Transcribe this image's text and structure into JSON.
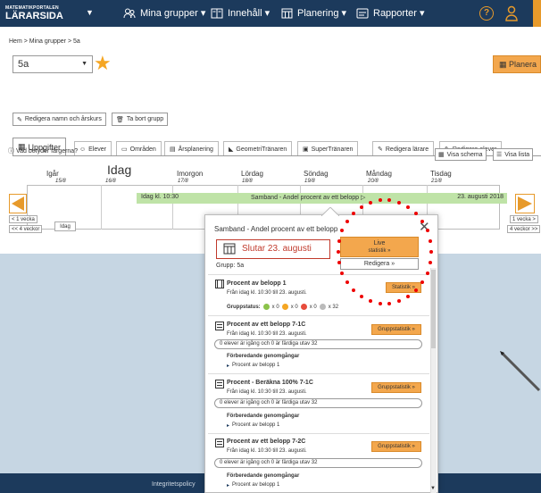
{
  "nav": {
    "logo_small": "MATEMATIKPORTALEN",
    "logo_big": "LÄRARSIDA",
    "items": [
      {
        "label": "Mina grupper ▾",
        "icon": "group-icon"
      },
      {
        "label": "Innehåll ▾",
        "icon": "book-icon"
      },
      {
        "label": "Planering ▾",
        "icon": "calendar-icon"
      },
      {
        "label": "Rapporter ▾",
        "icon": "report-icon"
      }
    ],
    "help": "?",
    "colors": {
      "navy": "#1c3a5c",
      "orange": "#e79a2b",
      "green": "#bfe3a7"
    }
  },
  "breadcrumb": "Hem > Mina grupper > 5a",
  "group_select": "5a",
  "planera": "Planera",
  "actions": {
    "rename": "Redigera namn och årskurs",
    "delete": "Ta bort grupp"
  },
  "tabs": [
    "Uppgifter",
    "Elever",
    "Områden",
    "Årsplanering",
    "GeometriTränaren",
    "SuperTränaren",
    "Redigera lärare",
    "Redigera elever"
  ],
  "legend": "Vad betyder färgerna?",
  "view": {
    "schedule": "Visa schema",
    "list": "Visa lista"
  },
  "days": [
    {
      "name": "Igår",
      "date": "15/8"
    },
    {
      "name": "Idag",
      "date": "16/8"
    },
    {
      "name": "Imorgon",
      "date": "17/8"
    },
    {
      "name": "Lördag",
      "date": "18/8"
    },
    {
      "name": "Söndag",
      "date": "19/8"
    },
    {
      "name": "Måndag",
      "date": "20/8"
    },
    {
      "name": "Tisdag",
      "date": "21/8"
    }
  ],
  "bar": {
    "start": "Idag kl. 10:30",
    "title": "Samband - Andel procent av ett belopp ▷",
    "end": "23. augusti 2018"
  },
  "nav_buttons": {
    "prev_week": "< 1 vecka",
    "prev_4": "<< 4 veckor",
    "today": "Idag",
    "next_week": "1 vecka >",
    "next_4": "4 veckor >>"
  },
  "popup": {
    "title": "Samband - Andel procent av ett belopp",
    "ends": "Slutar 23. augusti",
    "live_line1": "Live",
    "live_line2": "statistik »",
    "edit": "Redigera »",
    "group": "Grupp: 5a",
    "close": "✕",
    "first": {
      "title": "Procent av belopp 1",
      "sub": "Från idag kl. 10:30 till 23. augusti.",
      "status_label": "Gruppstatus:",
      "counts": [
        "x 0",
        "x 0",
        "x 0",
        "x 32"
      ],
      "btn": "Statistik »"
    },
    "items": [
      {
        "title": "Procent av ett belopp 7-1C",
        "sub": "Från idag kl. 10:30 till 23. augusti.",
        "progress": "0 elever är igång och 0 är färdiga utav 32",
        "prep": "Förberedande genomgångar",
        "prep_item": "Procent av belopp 1",
        "btn": "Gruppstatistik »"
      },
      {
        "title": "Procent - Beräkna 100% 7-1C",
        "sub": "Från idag kl. 10:30 till 23. augusti.",
        "progress": "0 elever är igång och 0 är färdiga utav 32",
        "prep": "Förberedande genomgångar",
        "prep_item": "Procent av belopp 1",
        "btn": "Gruppstatistik »"
      },
      {
        "title": "Procent av ett belopp 7-2C",
        "sub": "Från idag kl. 10:30 till 23. augusti.",
        "progress": "0 elever är igång och 0 är färdiga utav 32",
        "prep": "Förberedande genomgångar",
        "prep_item": "Procent av belopp 1",
        "btn": "Gruppstatistik »"
      }
    ]
  },
  "footer": "Integritetspolicy"
}
